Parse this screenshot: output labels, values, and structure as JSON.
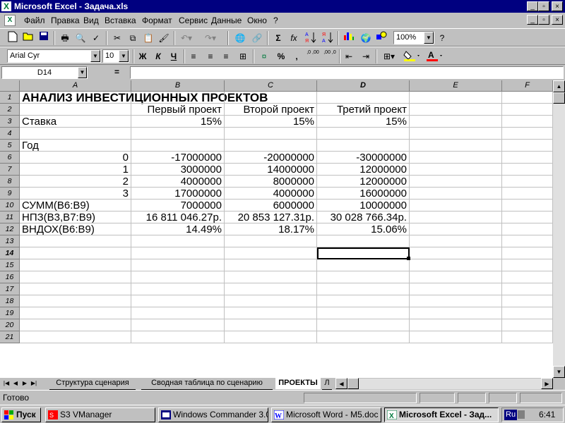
{
  "window": {
    "title": "Microsoft Excel - Задача.xls",
    "minimize": "_",
    "maximize": "▫",
    "close": "×"
  },
  "menu": [
    "Файл",
    "Правка",
    "Вид",
    "Вставка",
    "Формат",
    "Сервис",
    "Данные",
    "Окно",
    "?"
  ],
  "toolbar": {
    "zoom": "100%",
    "font": "Arial Cyr",
    "size": "10",
    "bold": "Ж",
    "italic": "К",
    "underline": "Ч",
    "sigma": "Σ",
    "fx": "fx",
    "percent": "%",
    "comma": ",",
    "inc_decimal": ",0 ,00",
    "dec_decimal": ",00 ,0"
  },
  "formula": {
    "namebox": "D14",
    "equals": "=",
    "content": ""
  },
  "columns": [
    "A",
    "B",
    "C",
    "D",
    "E",
    "F"
  ],
  "rows": [
    "1",
    "2",
    "3",
    "4",
    "5",
    "6",
    "7",
    "8",
    "9",
    "10",
    "11",
    "12",
    "13",
    "14",
    "15",
    "16",
    "17",
    "18",
    "19",
    "20",
    "21"
  ],
  "cells": {
    "A1": "АНАЛИЗ  ИНВЕСТИЦИОННЫХ  ПРОЕКТОВ",
    "B2": "Первый проект",
    "C2": "Второй проект",
    "D2": "Третий проект",
    "A3": "Ставка",
    "B3": "15%",
    "C3": "15%",
    "D3": "15%",
    "A5": "Год",
    "A6": "0",
    "B6": "-17000000",
    "C6": "-20000000",
    "D6": "-30000000",
    "A7": "1",
    "B7": "3000000",
    "C7": "14000000",
    "D7": "12000000",
    "A8": "2",
    "B8": "4000000",
    "C8": "8000000",
    "D8": "12000000",
    "A9": "3",
    "B9": "17000000",
    "C9": "4000000",
    "D9": "16000000",
    "A10": "СУММ(B6:B9)",
    "B10": "7000000",
    "C10": "6000000",
    "D10": "10000000",
    "A11": "НПЗ(B3,B7:B9)",
    "B11": "16 811 046.27р.",
    "C11": "20 853 127.31р.",
    "D11": "30 028 766.34р.",
    "A12": "ВНДОХ(B6:B9)",
    "B12": "14.49%",
    "C12": "18.17%",
    "D12": "15.06%"
  },
  "sheet_tabs": [
    "Структура сценария",
    "Сводная таблица по сценарию",
    "ПРОЕКТЫ",
    "Л"
  ],
  "status": "Готово",
  "taskbar": {
    "start": "Пуск",
    "items": [
      "S3 VManager",
      "Windows Commander 3.0...",
      "Microsoft Word - M5.doc",
      "Microsoft Excel - Зад..."
    ],
    "lang": "Ru",
    "clock": "6:41"
  },
  "colors": {
    "title_bg": "#000080",
    "excel_green": "#007a3d"
  }
}
